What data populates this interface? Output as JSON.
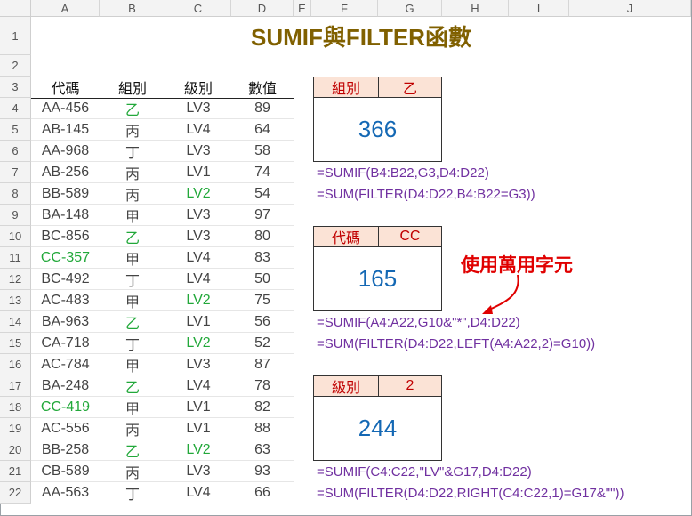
{
  "title": "SUMIF與FILTER函數",
  "columns": [
    "A",
    "B",
    "C",
    "D",
    "E",
    "F",
    "G",
    "H",
    "I",
    "J"
  ],
  "row_numbers": [
    "1",
    "2",
    "3",
    "4",
    "5",
    "6",
    "7",
    "8",
    "9",
    "10",
    "11",
    "12",
    "13",
    "14",
    "15",
    "16",
    "17",
    "18",
    "19",
    "20",
    "21",
    "22"
  ],
  "table": {
    "headers": [
      "代碼",
      "組別",
      "級別",
      "數值"
    ],
    "rows": [
      {
        "code": "AA-456",
        "group": "乙",
        "level": "LV3",
        "value": "89"
      },
      {
        "code": "AB-145",
        "group": "丙",
        "level": "LV4",
        "value": "64"
      },
      {
        "code": "AA-968",
        "group": "丁",
        "level": "LV3",
        "value": "58"
      },
      {
        "code": "AB-256",
        "group": "丙",
        "level": "LV1",
        "value": "74"
      },
      {
        "code": "BB-589",
        "group": "丙",
        "level": "LV2",
        "value": "54"
      },
      {
        "code": "BA-148",
        "group": "甲",
        "level": "LV3",
        "value": "97"
      },
      {
        "code": "BC-856",
        "group": "乙",
        "level": "LV3",
        "value": "80"
      },
      {
        "code": "CC-357",
        "group": "甲",
        "level": "LV4",
        "value": "83"
      },
      {
        "code": "BC-492",
        "group": "丁",
        "level": "LV4",
        "value": "50"
      },
      {
        "code": "AC-483",
        "group": "甲",
        "level": "LV2",
        "value": "75"
      },
      {
        "code": "BA-963",
        "group": "乙",
        "level": "LV1",
        "value": "56"
      },
      {
        "code": "CA-718",
        "group": "丁",
        "level": "LV2",
        "value": "52"
      },
      {
        "code": "AC-784",
        "group": "甲",
        "level": "LV3",
        "value": "87"
      },
      {
        "code": "BA-248",
        "group": "乙",
        "level": "LV4",
        "value": "78"
      },
      {
        "code": "CC-419",
        "group": "甲",
        "level": "LV1",
        "value": "82"
      },
      {
        "code": "AC-556",
        "group": "丙",
        "level": "LV1",
        "value": "88"
      },
      {
        "code": "BB-258",
        "group": "乙",
        "level": "LV2",
        "value": "63"
      },
      {
        "code": "CB-589",
        "group": "丙",
        "level": "LV3",
        "value": "93"
      },
      {
        "code": "AA-563",
        "group": "丁",
        "level": "LV4",
        "value": "66"
      }
    ]
  },
  "criteria": [
    {
      "label": "組別",
      "value": "乙",
      "result": "366",
      "formula1": "=SUMIF(B4:B22,G3,D4:D22)",
      "formula2": "=SUM(FILTER(D4:D22,B4:B22=G3))"
    },
    {
      "label": "代碼",
      "value": "CC",
      "result": "165",
      "formula1": "=SUMIF(A4:A22,G10&\"*\",D4:D22)",
      "formula2": "=SUM(FILTER(D4:D22,LEFT(A4:A22,2)=G10))"
    },
    {
      "label": "級別",
      "value": "2",
      "result": "244",
      "formula1": "=SUMIF(C4:C22,\"LV\"&G17,D4:D22)",
      "formula2": "=SUM(FILTER(D4:D22,RIGHT(C4:C22,1)=G17&\"\"))"
    }
  ],
  "note": "使用萬用字元",
  "colors": {
    "title": "#806000",
    "label_bg": "#fbe3d6",
    "label_text": "#c00000",
    "result": "#1468b4",
    "formula": "#7030a0",
    "highlight": "#22a83a",
    "arrow": "#e00000"
  }
}
